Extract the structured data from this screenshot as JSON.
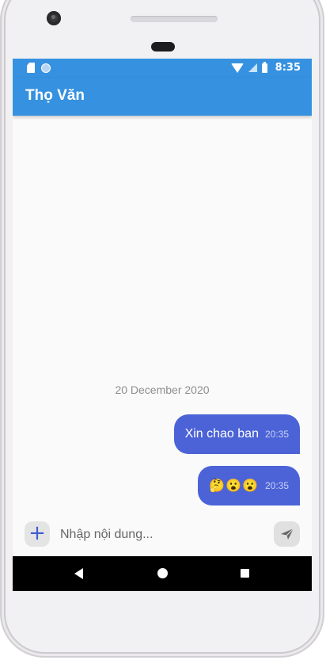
{
  "status_bar": {
    "time": "8:35"
  },
  "app_bar": {
    "title": "Thọ Văn"
  },
  "chat": {
    "date_separator": "20 December 2020",
    "messages": [
      {
        "text": "Xin chao ban",
        "time": "20:35"
      },
      {
        "text": "🤔😮😮",
        "time": "20:35"
      }
    ]
  },
  "composer": {
    "placeholder": "Nhập nội dung...",
    "add_icon_glyph": "+"
  },
  "colors": {
    "primary": "#3692e0",
    "bubble": "#4b63d6"
  },
  "icons": [
    "sim-card-icon",
    "notification-dot-icon",
    "wifi-icon",
    "signal-icon",
    "battery-icon",
    "add-icon",
    "send-icon",
    "back-icon",
    "home-icon",
    "recents-icon"
  ]
}
